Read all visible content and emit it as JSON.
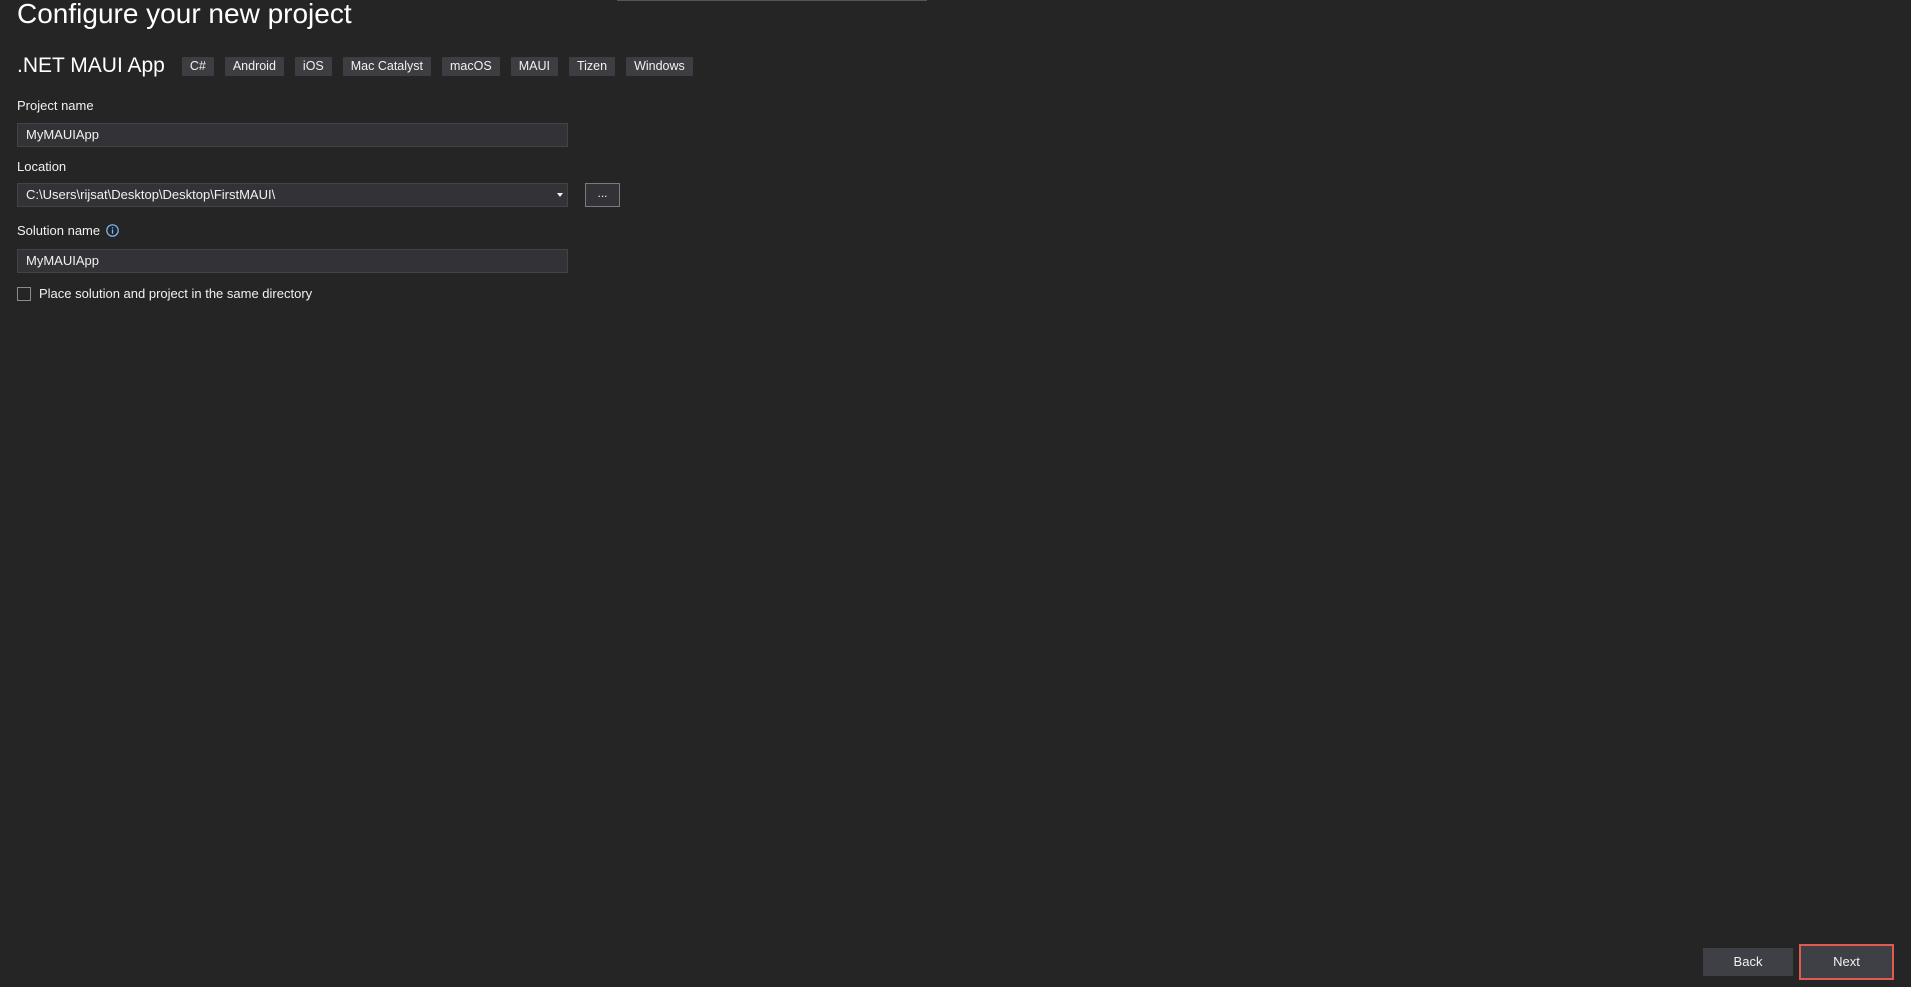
{
  "page": {
    "title": "Configure your new project"
  },
  "template": {
    "name": ".NET MAUI App",
    "tags": [
      "C#",
      "Android",
      "iOS",
      "Mac Catalyst",
      "macOS",
      "MAUI",
      "Tizen",
      "Windows"
    ]
  },
  "project_name": {
    "label": "Project name",
    "value": "MyMAUIApp"
  },
  "location": {
    "label": "Location",
    "value": "C:\\Users\\rijsat\\Desktop\\Desktop\\FirstMAUI\\",
    "browse_label": "..."
  },
  "solution_name": {
    "label": "Solution name",
    "value": "MyMAUIApp",
    "info_icon": "info-icon"
  },
  "same_directory": {
    "label": "Place solution and project in the same directory",
    "checked": false
  },
  "footer": {
    "back_label": "Back",
    "next_label": "Next"
  },
  "colors": {
    "background": "#252526",
    "input_background": "#333337",
    "tag_background": "#3e3e42",
    "highlight_border": "#e05a4f",
    "info_icon": "#75bfff"
  }
}
